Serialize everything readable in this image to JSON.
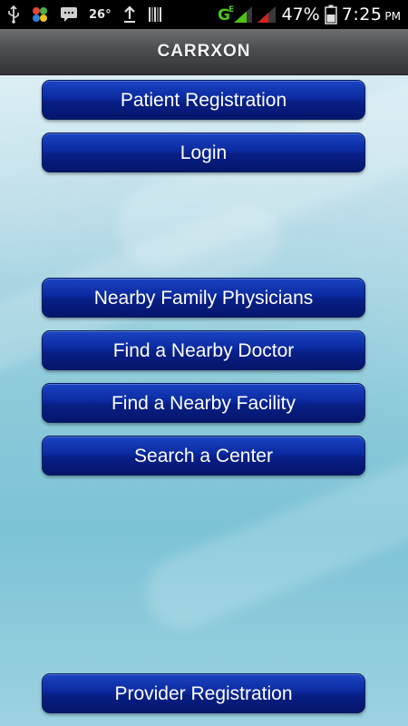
{
  "status_bar": {
    "temperature": "26°",
    "battery_percent": "47%",
    "time": "7:25",
    "time_suffix": "PM",
    "network_label": "G",
    "network_sub": "E",
    "icons": [
      "usb-icon",
      "app-icon",
      "chat-icon",
      "upload-icon",
      "barcode-icon",
      "signal-icon",
      "battery-icon"
    ]
  },
  "header": {
    "title": "CARRXON"
  },
  "buttons": {
    "patient_registration": "Patient Registration",
    "login": "Login",
    "nearby_family_physicians": "Nearby Family Physicians",
    "find_nearby_doctor": "Find a Nearby Doctor",
    "find_nearby_facility": "Find a Nearby Facility",
    "search_center": "Search a Center",
    "provider_registration": "Provider Registration"
  },
  "colors": {
    "button_top": "#1a44c2",
    "button_bottom": "#04156a",
    "header_top": "#6d6f72",
    "header_bottom": "#323436",
    "background": "#8ccad9",
    "signal_green": "#4cc417",
    "signal_red": "#d32020"
  }
}
